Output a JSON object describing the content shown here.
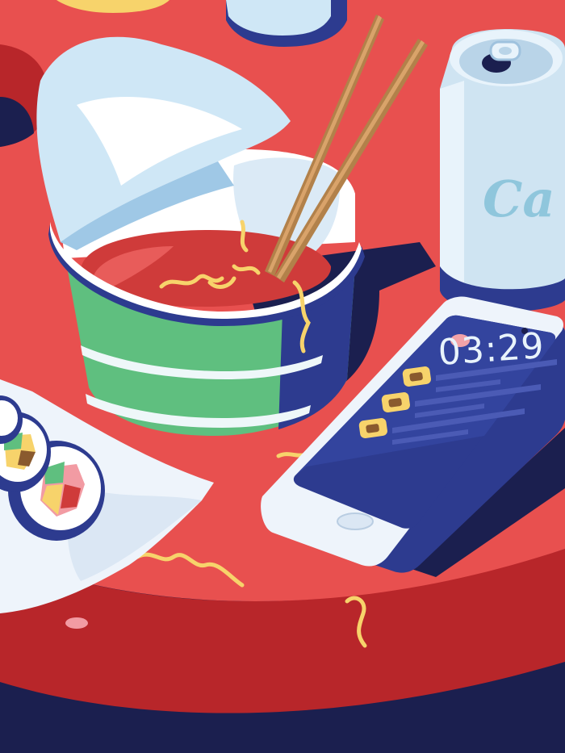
{
  "scene": {
    "title": "",
    "colors": {
      "table_red": "#e8504f",
      "table_edge_red": "#b8262a",
      "navy": "#1b1f4f",
      "cup_green": "#5fbf7f",
      "broth_red": "#cf3b3a",
      "noodle_yellow": "#f7d36b",
      "lid_blue": "#cfe7f6",
      "phone_white": "#eef4fb",
      "screen_blue": "#2d3b8f",
      "can_light": "#cfe4f2"
    },
    "icons": [
      "chopsticks-icon",
      "pull-tab-icon",
      "notification-icon",
      "camera-icon"
    ]
  },
  "phone": {
    "clock": "03:29",
    "notifications": [
      {
        "kind": "message"
      },
      {
        "kind": "message"
      },
      {
        "kind": "message"
      }
    ]
  },
  "can": {
    "mark": "Ca"
  }
}
